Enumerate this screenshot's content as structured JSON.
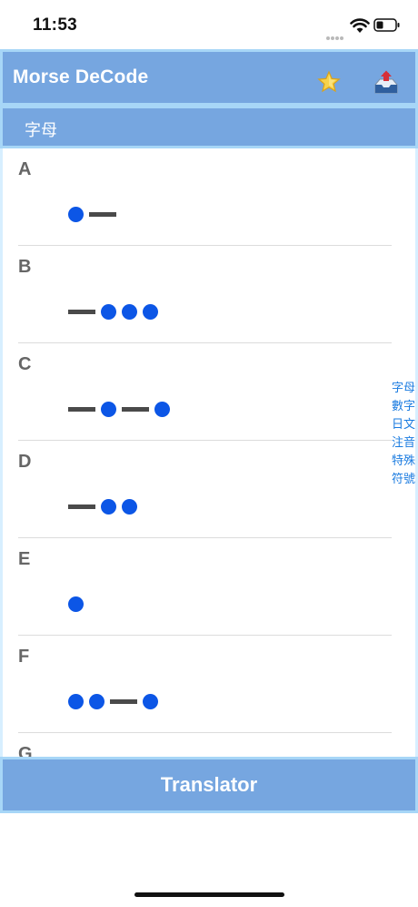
{
  "status_bar": {
    "time": "11:53"
  },
  "header": {
    "title": "Morse DeCode",
    "favorites_icon": "star-icon",
    "export_icon": "inbox-export-icon"
  },
  "section": {
    "title": "字母"
  },
  "rows": [
    {
      "letter": "A",
      "code": ".-"
    },
    {
      "letter": "B",
      "code": "-..."
    },
    {
      "letter": "C",
      "code": "-.-."
    },
    {
      "letter": "D",
      "code": "-.."
    },
    {
      "letter": "E",
      "code": "."
    },
    {
      "letter": "F",
      "code": "..-."
    },
    {
      "letter": "G",
      "code": ""
    }
  ],
  "side_index": [
    "字母",
    "數字",
    "日文",
    "注音",
    "特殊",
    "符號"
  ],
  "footer": {
    "translator_label": "Translator"
  },
  "colors": {
    "accent": "#76a6e0",
    "border": "#a7d6f7",
    "dot": "#0c56e6",
    "dash": "#4a4a4a",
    "index_text": "#1a7be0"
  }
}
